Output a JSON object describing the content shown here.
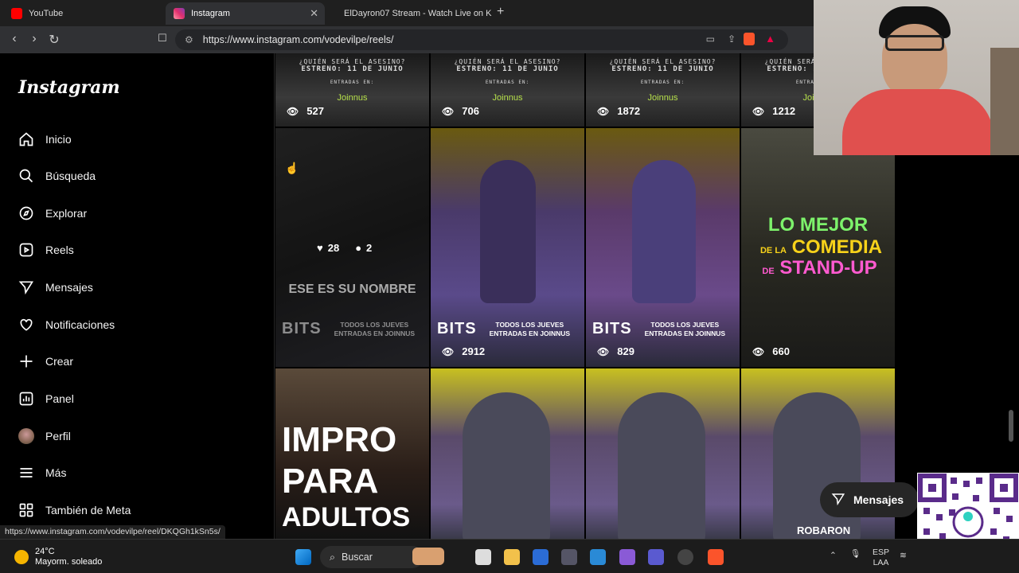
{
  "browser": {
    "tabs": [
      {
        "label": "YouTube",
        "active": false,
        "icon": "youtube-icon",
        "color": "#ff0000"
      },
      {
        "label": "Instagram",
        "active": true,
        "icon": "instagram-icon",
        "color": "#e1306c"
      },
      {
        "label": "ElDayron07 Stream - Watch Live on K",
        "active": false,
        "icon": "kick-icon",
        "color": "#53fc18"
      }
    ],
    "url": "https://www.instagram.com/vodevilpe/reels/",
    "status_url": "https://www.instagram.com/vodevilpe/reel/DKQGh1kSn5s/"
  },
  "instagram": {
    "logo": "Instagram",
    "nav": [
      {
        "label": "Inicio",
        "icon": "home-icon"
      },
      {
        "label": "Búsqueda",
        "icon": "search-icon"
      },
      {
        "label": "Explorar",
        "icon": "compass-icon"
      },
      {
        "label": "Reels",
        "icon": "reels-icon"
      },
      {
        "label": "Mensajes",
        "icon": "send-icon"
      },
      {
        "label": "Notificaciones",
        "icon": "heart-icon"
      },
      {
        "label": "Crear",
        "icon": "plus-icon"
      },
      {
        "label": "Panel",
        "icon": "chart-icon"
      },
      {
        "label": "Perfil",
        "icon": "avatar"
      },
      {
        "label": "Más",
        "icon": "menu-icon"
      },
      {
        "label": "También de Meta",
        "icon": "meta-grid-icon"
      }
    ],
    "reels_row1": [
      {
        "views": "527",
        "line1": "¿QUIÉN SERÁ EL ASESINO?",
        "line2": "ESTRENO: 11 DE JUNIO",
        "line3": "ENTRADAS EN:",
        "brand": "Joinnus"
      },
      {
        "views": "706",
        "line1": "¿QUIÉN SERÁ EL ASESINO?",
        "line2": "ESTRENO: 11 DE JUNIO",
        "line3": "ENTRADAS EN:",
        "brand": "Joinnus"
      },
      {
        "views": "1872",
        "line1": "¿QUIÉN SERÁ EL ASESINO?",
        "line2": "ESTRENO: 11 DE JUNIO",
        "line3": "ENTRADAS EN:",
        "brand": "Joinnus"
      },
      {
        "views": "1212",
        "line1": "¿QUIÉN SERÁ EL ASESINO?",
        "line2": "ESTRENO: 11 DE JUNIO",
        "line3": "ENTRADAS EN:",
        "brand": "Joinnus"
      }
    ],
    "reels_row2": [
      {
        "likes": "28",
        "comments": "2",
        "caption": "ESE ES SU NOMBRE",
        "bits": "BITS",
        "msg1": "TODOS LOS JUEVES",
        "msg2": "ENTRADAS EN JOINNUS"
      },
      {
        "views": "2912",
        "bits": "BITS",
        "msg1": "TODOS LOS JUEVES",
        "msg2": "ENTRADAS EN JOINNUS"
      },
      {
        "views": "829",
        "bits": "BITS",
        "msg1": "TODOS LOS JUEVES",
        "msg2": "ENTRADAS EN JOINNUS"
      },
      {
        "views": "660",
        "title1": "LO MEJOR",
        "title2a": "DE LA",
        "title2b": "COMEDIA",
        "title3a": "DE",
        "title3b": "STAND-UP"
      }
    ],
    "reels_row3": [
      {
        "title1": "IMPRO",
        "title2": "PARA",
        "title3": "ADULTOS"
      },
      {},
      {},
      {
        "caption": "ROBARON"
      }
    ],
    "messages_button": "Mensajes"
  },
  "taskbar": {
    "temp": "24°C",
    "weather": "Mayorm. soleado",
    "search_placeholder": "Buscar",
    "lang1": "ESP",
    "lang2": "LAA"
  }
}
